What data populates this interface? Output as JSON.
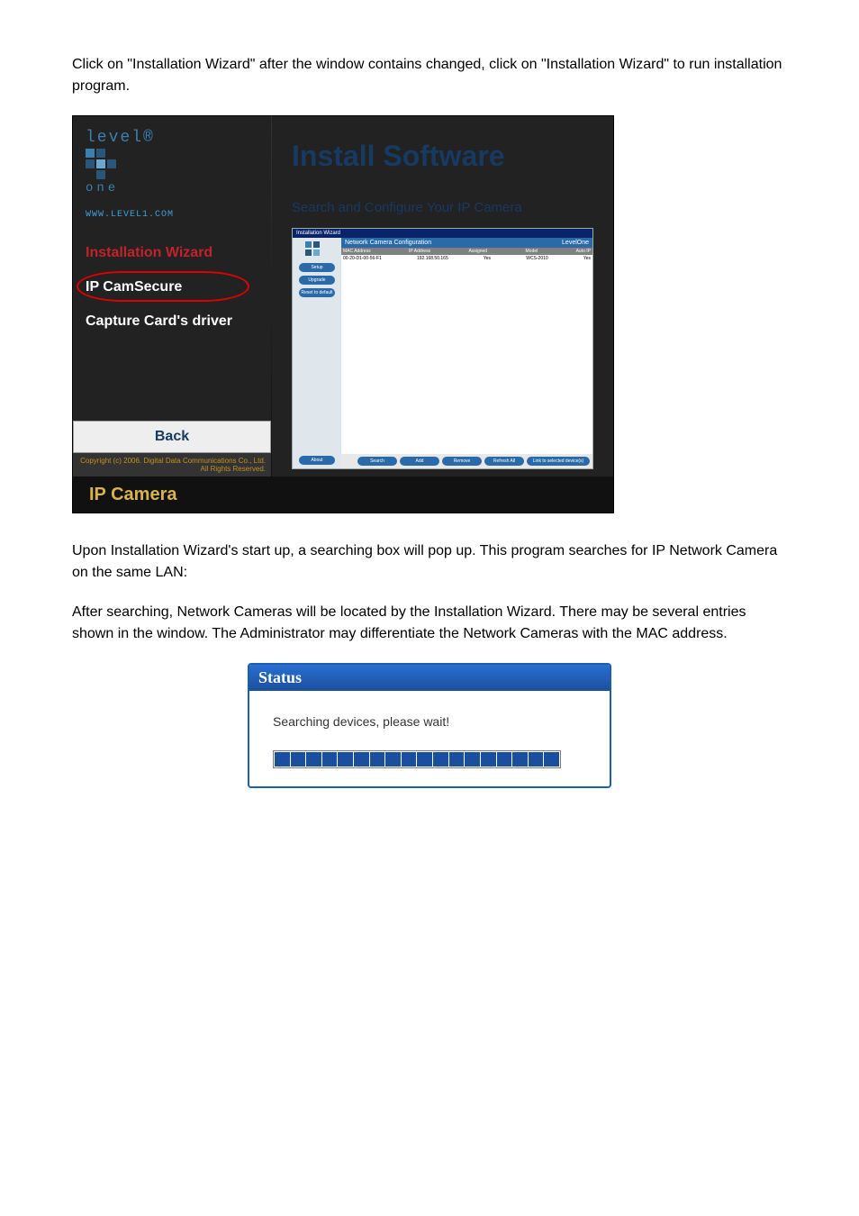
{
  "paragraphs": {
    "p1": "Click on \"Installation Wizard\" after the window contains changed, click on \"Installation Wizard\" to run installation program.",
    "p2": "Upon Installation Wizard's start up, a searching box will pop up. This program searches for IP Network Camera on the same LAN:",
    "p3": "After searching, Network Cameras will be located by the Installation Wizard. There may be several entries shown in the window. The Administrator may differentiate the Network Cameras with the MAC address."
  },
  "installer": {
    "brand_top": "level®",
    "brand_one": "one",
    "brand_url": "WWW.LEVEL1.COM",
    "menu": {
      "wizard": "Installation Wizard",
      "camsecure": "IP CamSecure",
      "driver": "Capture Card's driver"
    },
    "back": "Back",
    "copyright": "Copyright (c) 2006. Digital Data Communications Co., Ltd.  All Rights Reserved.",
    "right": {
      "title": "Install Software",
      "subtitle": "Search and Configure Your IP Camera"
    },
    "bottom": "IP Camera",
    "mini": {
      "window_title": "Installation Wizard",
      "header_text": "Network Camera Configuration",
      "brand": "LevelOne",
      "side_btns": {
        "setup": "Setup",
        "upgrade": "Upgrade",
        "reset": "Reset to default",
        "about": "About"
      },
      "cols": {
        "mac": "MAC Address",
        "ip": "IP Address",
        "assigned": "Assigned",
        "model": "Model",
        "auto": "Auto IP"
      },
      "row": {
        "mac": "00-20-D1-00-56-F1",
        "ip": "192.168.50.165",
        "assigned": "Yes",
        "model": "WCS-2010",
        "auto": "Yes"
      },
      "bottom_btns": {
        "search": "Search",
        "add": "Add",
        "remove": "Remove",
        "refresh_all": "Refresh All",
        "link": "Link to selected device(s)"
      }
    }
  },
  "status": {
    "title": "Status",
    "message": "Searching devices, please wait!"
  },
  "chart_data": {
    "type": "bar",
    "title": "Progress indicator",
    "note": "Search progress bar (indeterminate — fully filled segments)",
    "segments_total": 18,
    "segments_filled": 18
  }
}
